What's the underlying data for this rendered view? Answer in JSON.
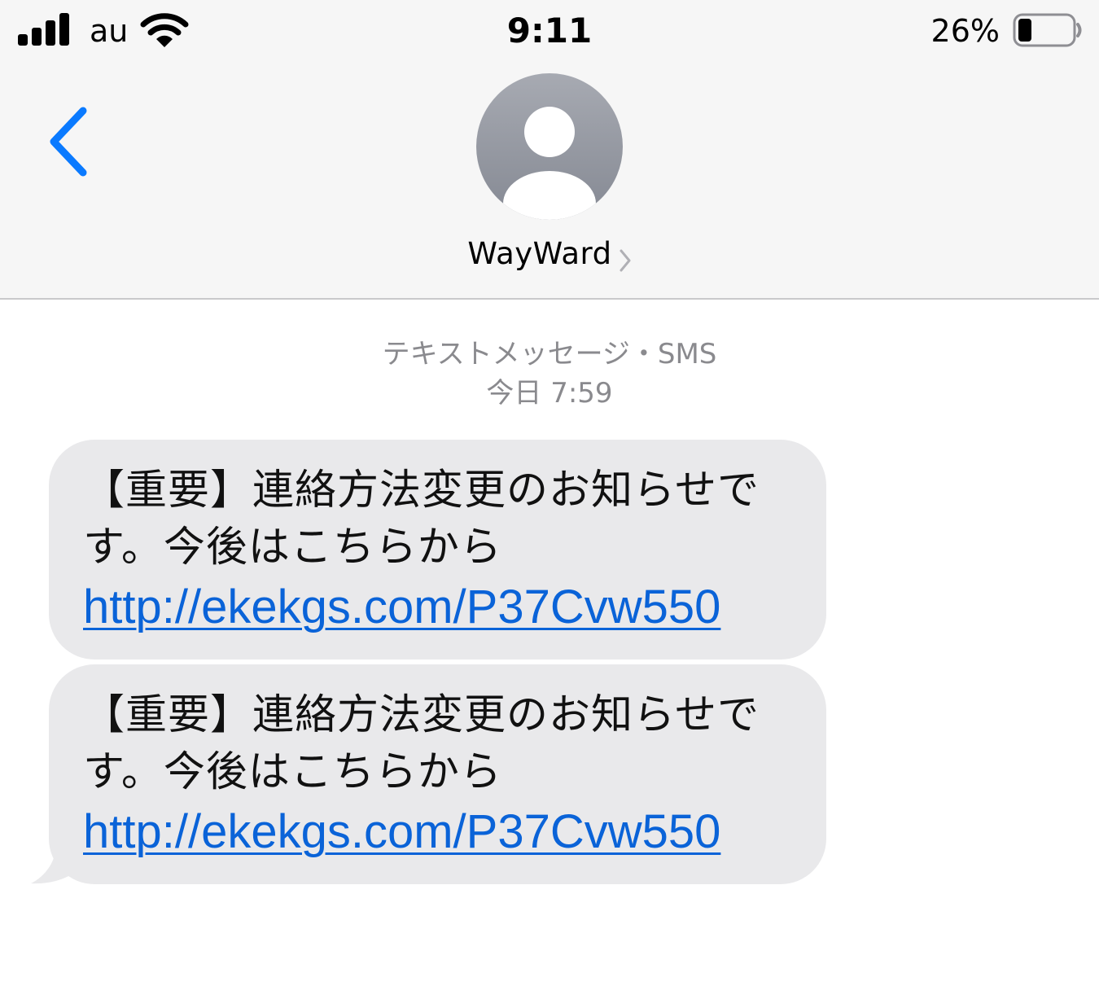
{
  "status_bar": {
    "carrier": "au",
    "time": "9:11",
    "battery_percent": "26%",
    "signal_icon": "cellular-signal-icon",
    "wifi_icon": "wifi-icon",
    "battery_icon": "battery-icon",
    "battery_level": 0.26
  },
  "header": {
    "back_icon": "chevron-left-icon",
    "avatar_icon": "contact-avatar-icon",
    "contact_name": "WayWard",
    "detail_icon": "chevron-right-icon"
  },
  "conversation": {
    "service_label": "テキストメッセージ・SMS",
    "timestamp": "今日 7:59",
    "messages": [
      {
        "line1": "【重要】連絡方法変更のお知らせで",
        "line2": "す。今後はこちらから",
        "link": "http://ekekgs.com/P37Cvw550"
      },
      {
        "line1": "【重要】連絡方法変更のお知らせで",
        "line2": "す。今後はこちらから",
        "link": "http://ekekgs.com/P37Cvw550"
      }
    ]
  },
  "colors": {
    "accent": "#0a7aff",
    "link": "#0a63d8",
    "bubble_incoming": "#e9e9eb",
    "header_bg": "#f6f6f6",
    "meta_text": "#8a8a8e",
    "avatar_gradient_top": "#a7aab2",
    "avatar_gradient_bottom": "#858993"
  }
}
